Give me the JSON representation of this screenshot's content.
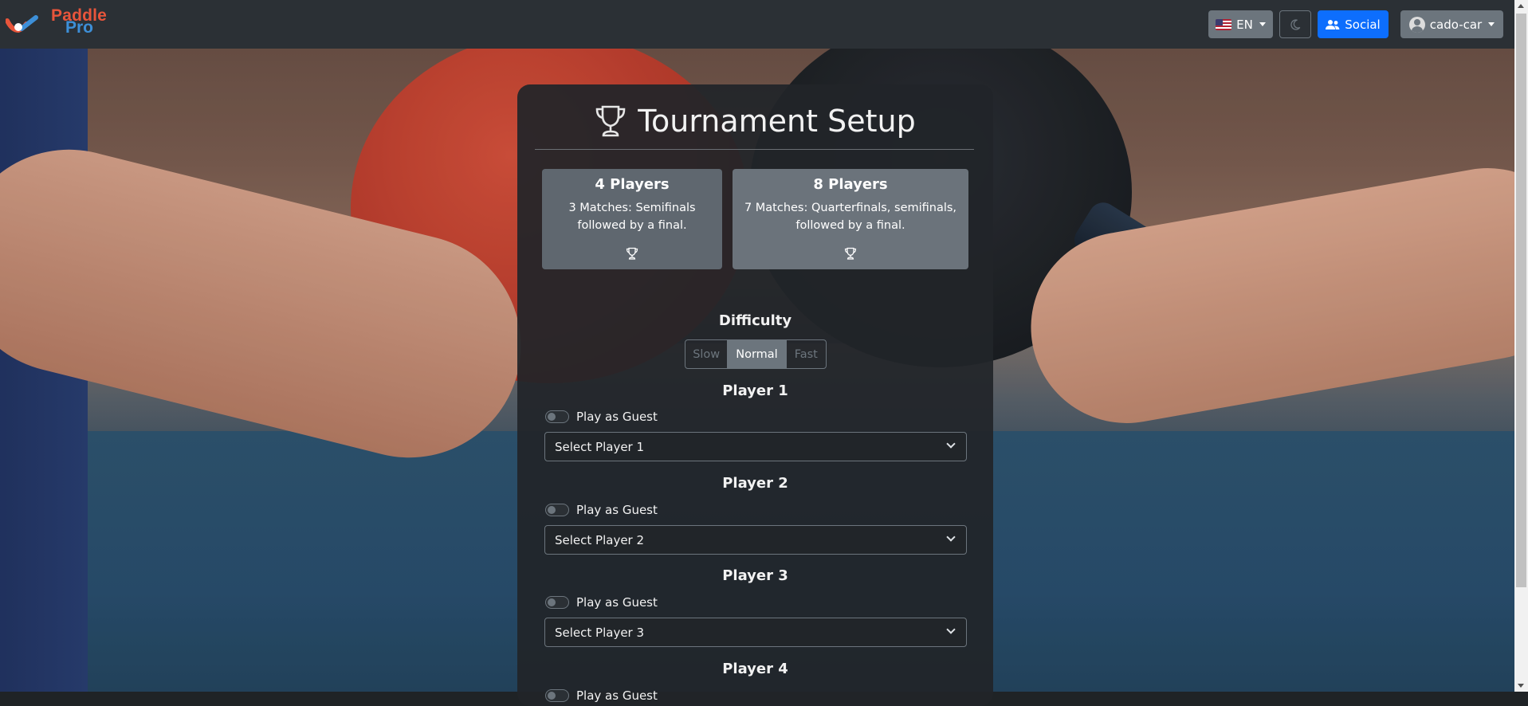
{
  "brand": {
    "word1": "Paddle",
    "word2": "Pro",
    "logo_icon": "paddle-pro-logo"
  },
  "navbar": {
    "language": "EN",
    "language_icon": "us-flag-icon",
    "theme_icon": "moon-icon",
    "social_label": "Social",
    "social_icon": "users-icon",
    "username": "cado-car",
    "avatar_icon": "user-avatar-icon"
  },
  "setup": {
    "title": "Tournament Setup",
    "title_icon": "trophy-icon",
    "options": [
      {
        "title": "4 Players",
        "description": "3 Matches: Semifinals followed by a final.",
        "icon": "trophy-icon"
      },
      {
        "title": "8 Players",
        "description": "7 Matches: Quarterfinals, semifinals, followed by a final.",
        "icon": "trophy-icon"
      }
    ],
    "difficulty": {
      "heading": "Difficulty",
      "options": [
        "Slow",
        "Normal",
        "Fast"
      ],
      "selected": "Normal"
    },
    "players": [
      {
        "heading": "Player 1",
        "guest_label": "Play as Guest",
        "select_label": "Select Player 1"
      },
      {
        "heading": "Player 2",
        "guest_label": "Play as Guest",
        "select_label": "Select Player 2"
      },
      {
        "heading": "Player 3",
        "guest_label": "Play as Guest",
        "select_label": "Select Player 3"
      },
      {
        "heading": "Player 4",
        "guest_label": "Play as Guest"
      }
    ]
  },
  "colors": {
    "navbar_bg": "#2b3035",
    "card_bg": "#212529",
    "primary": "#0d6efd",
    "secondary": "#6c757d",
    "brand_red": "#e8553b",
    "brand_blue": "#3d8fd8"
  }
}
